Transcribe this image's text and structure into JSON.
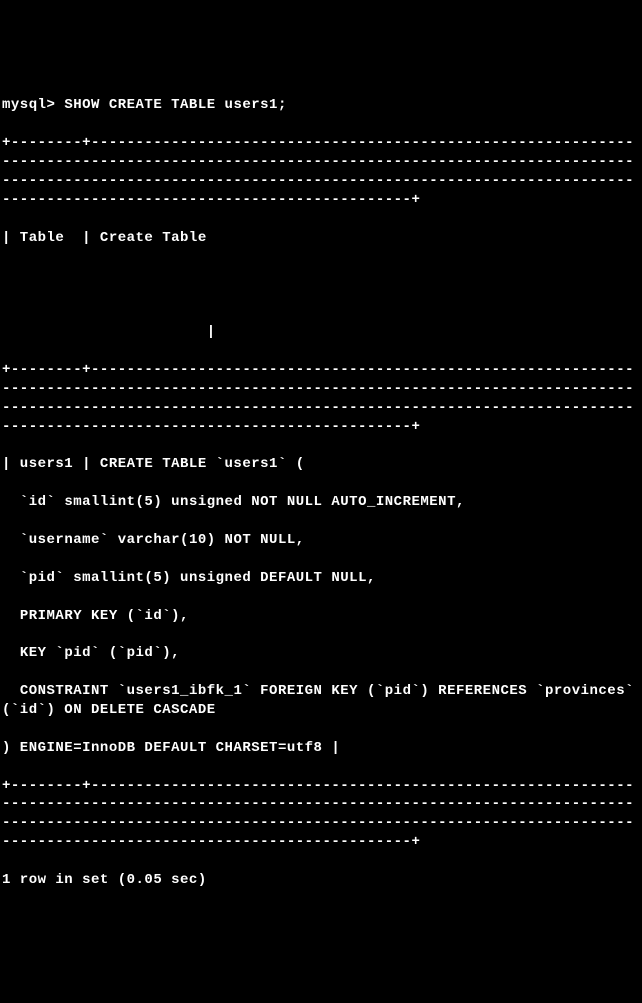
{
  "terminal": {
    "prompt": "mysql> ",
    "command": "SHOW CREATE TABLE users1;",
    "sep_long": "+--------+---------------------------------------------------------------------------------------------------------------------------------------------------------------------------------------------------------------------------------------------------------+",
    "header": "| Table  | Create Table",
    "blank": "",
    "header_tail": "                       |",
    "row_l1": "| users1 | CREATE TABLE `users1` (",
    "row_l2": "  `id` smallint(5) unsigned NOT NULL AUTO_INCREMENT,",
    "row_l3": "  `username` varchar(10) NOT NULL,",
    "row_l4": "  `pid` smallint(5) unsigned DEFAULT NULL,",
    "row_l5": "  PRIMARY KEY (`id`),",
    "row_l6": "  KEY `pid` (`pid`),",
    "row_l7": "  CONSTRAINT `users1_ibfk_1` FOREIGN KEY (`pid`) REFERENCES `provinces` (`id`) ON DELETE CASCADE",
    "row_l8": ") ENGINE=InnoDB DEFAULT CHARSET=utf8 |",
    "footer": "1 row in set (0.05 sec)"
  }
}
